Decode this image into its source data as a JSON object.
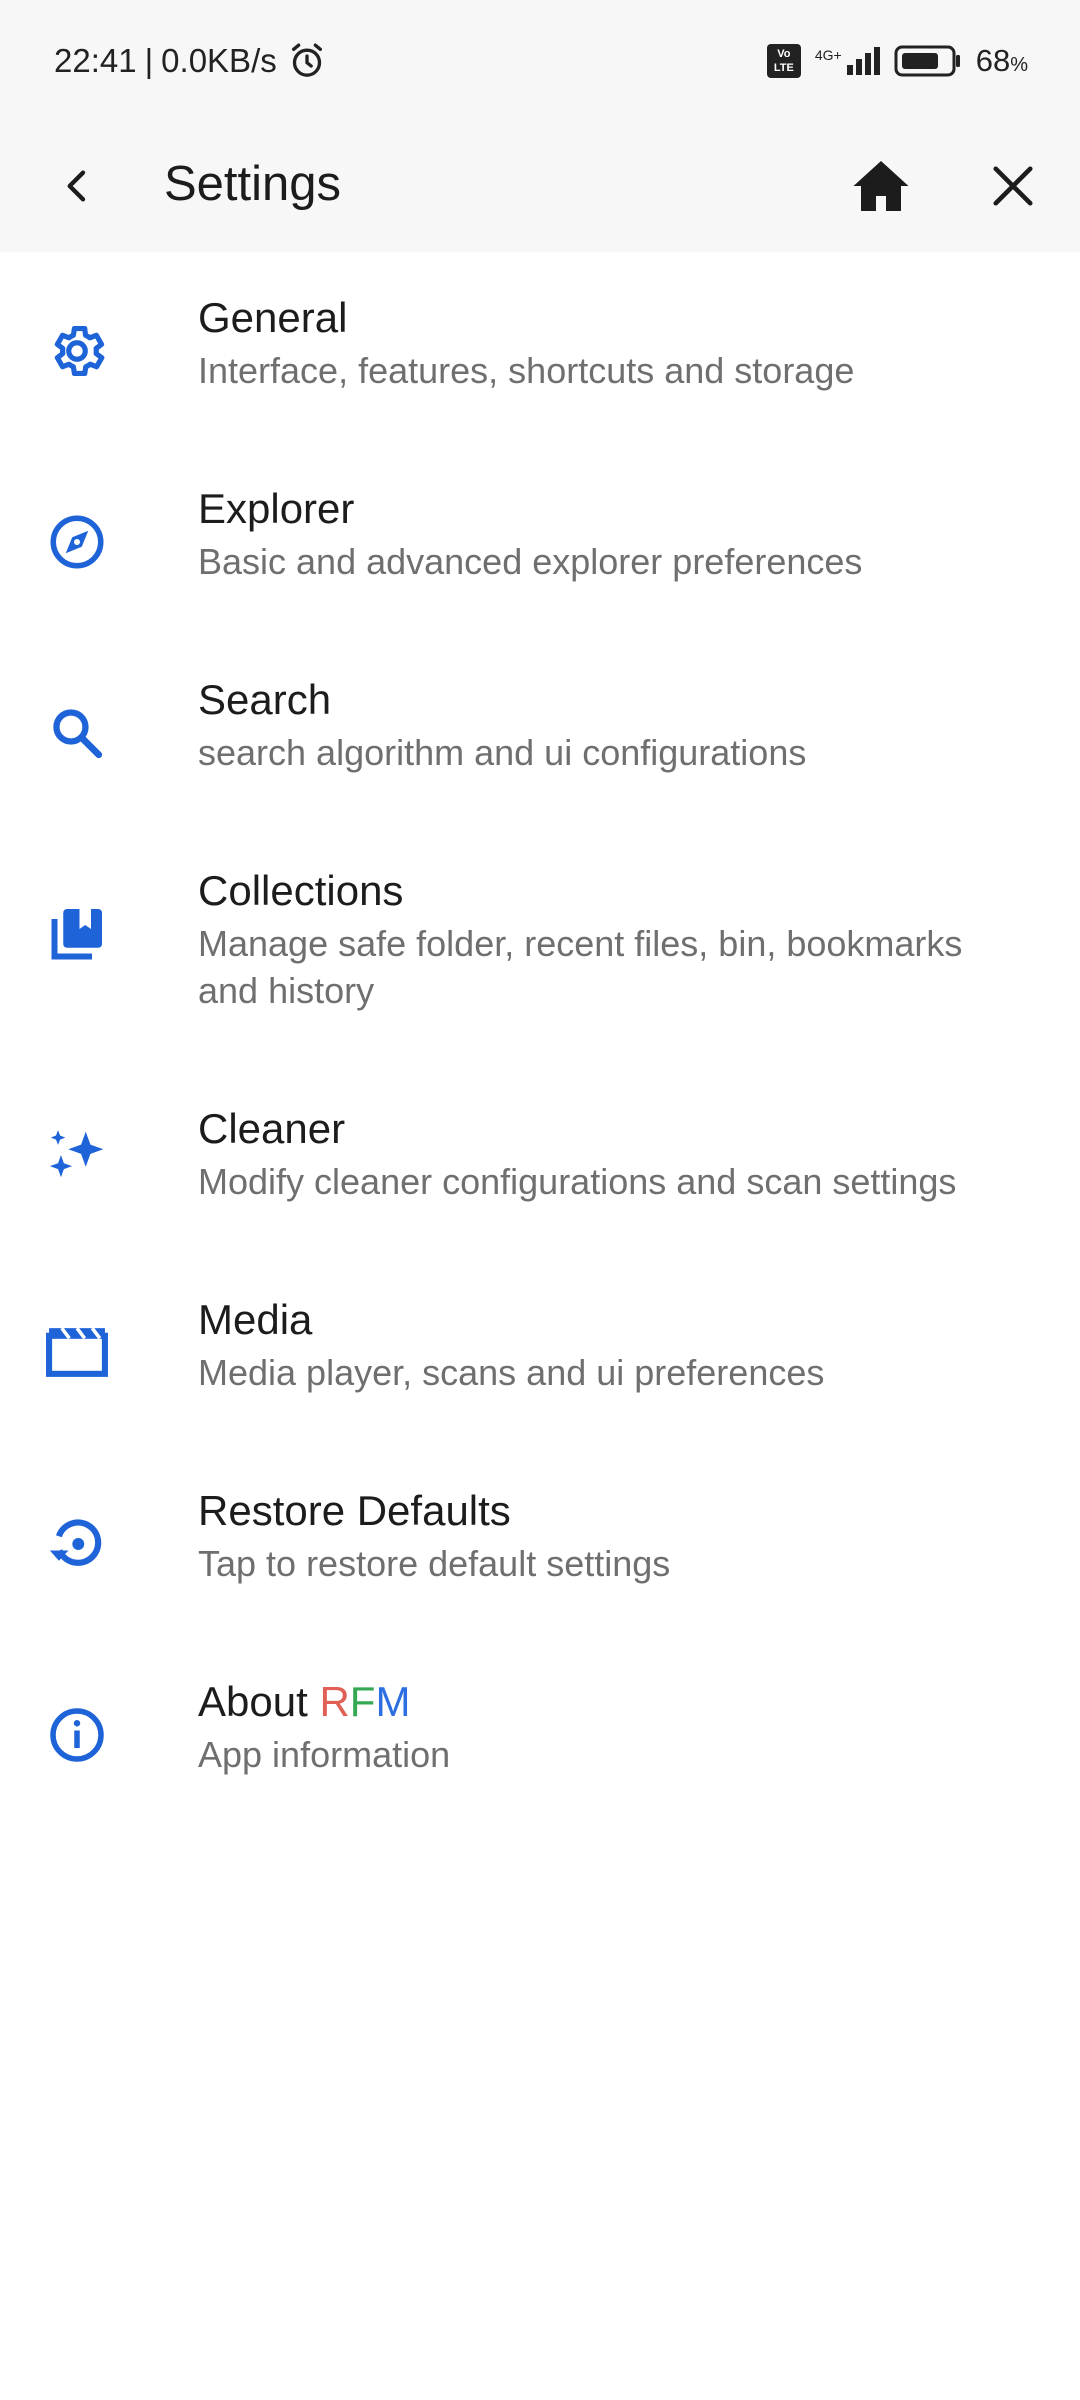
{
  "status_bar": {
    "time": "22:41",
    "separator": "|",
    "speed": "0.0KB/s",
    "volte_top": "Vo",
    "volte_bottom": "LTE",
    "network": "4G+",
    "battery": "68",
    "battery_unit": "%"
  },
  "app_bar": {
    "title": "Settings"
  },
  "items": [
    {
      "title": "General",
      "subtitle": "Interface, features, shortcuts and storage",
      "icon": "gear-icon"
    },
    {
      "title": "Explorer",
      "subtitle": "Basic and advanced explorer preferences",
      "icon": "compass-icon"
    },
    {
      "title": "Search",
      "subtitle": "search algorithm and ui configurations",
      "icon": "search-icon"
    },
    {
      "title": "Collections",
      "subtitle": "Manage safe folder, recent files, bin, bookmarks and history",
      "icon": "collections-icon"
    },
    {
      "title": "Cleaner",
      "subtitle": "Modify cleaner configurations and scan settings",
      "icon": "sparkle-icon"
    },
    {
      "title": "Media",
      "subtitle": "Media player, scans and ui preferences",
      "icon": "clapperboard-icon"
    },
    {
      "title": "Restore Defaults",
      "subtitle": "Tap to restore default settings",
      "icon": "restore-icon"
    },
    {
      "title_prefix": "About ",
      "title_r": "R",
      "title_f": "F",
      "title_m": "M",
      "subtitle": "App information",
      "icon": "info-icon"
    }
  ],
  "colors": {
    "accent": "#1e63d8",
    "topbar_bg": "#f7f7f7",
    "rfm_r": "#e06055",
    "rfm_f": "#34a853",
    "rfm_m": "#2d6fe0"
  }
}
